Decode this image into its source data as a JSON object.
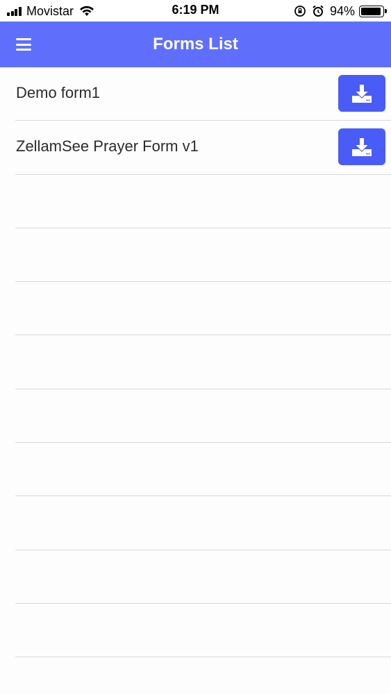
{
  "status_bar": {
    "carrier": "Movistar",
    "time": "6:19 PM",
    "battery": "94%",
    "icons": [
      "signal-icon",
      "wifi-icon",
      "orientation-lock-icon",
      "alarm-icon",
      "battery-icon"
    ]
  },
  "header": {
    "title": "Forms List",
    "menu_icon": "menu-icon",
    "background": "#5f6ffc"
  },
  "forms": [
    {
      "name": "Demo form1",
      "action_icon": "download-icon"
    },
    {
      "name": "ZellamSee Prayer Form v1",
      "action_icon": "download-icon"
    },
    {
      "name": ""
    },
    {
      "name": ""
    },
    {
      "name": ""
    },
    {
      "name": ""
    },
    {
      "name": ""
    },
    {
      "name": ""
    },
    {
      "name": ""
    },
    {
      "name": ""
    },
    {
      "name": ""
    },
    {
      "name": ""
    }
  ],
  "colors": {
    "accent": "#4a5cf7",
    "divider": "#d9d9d9"
  }
}
